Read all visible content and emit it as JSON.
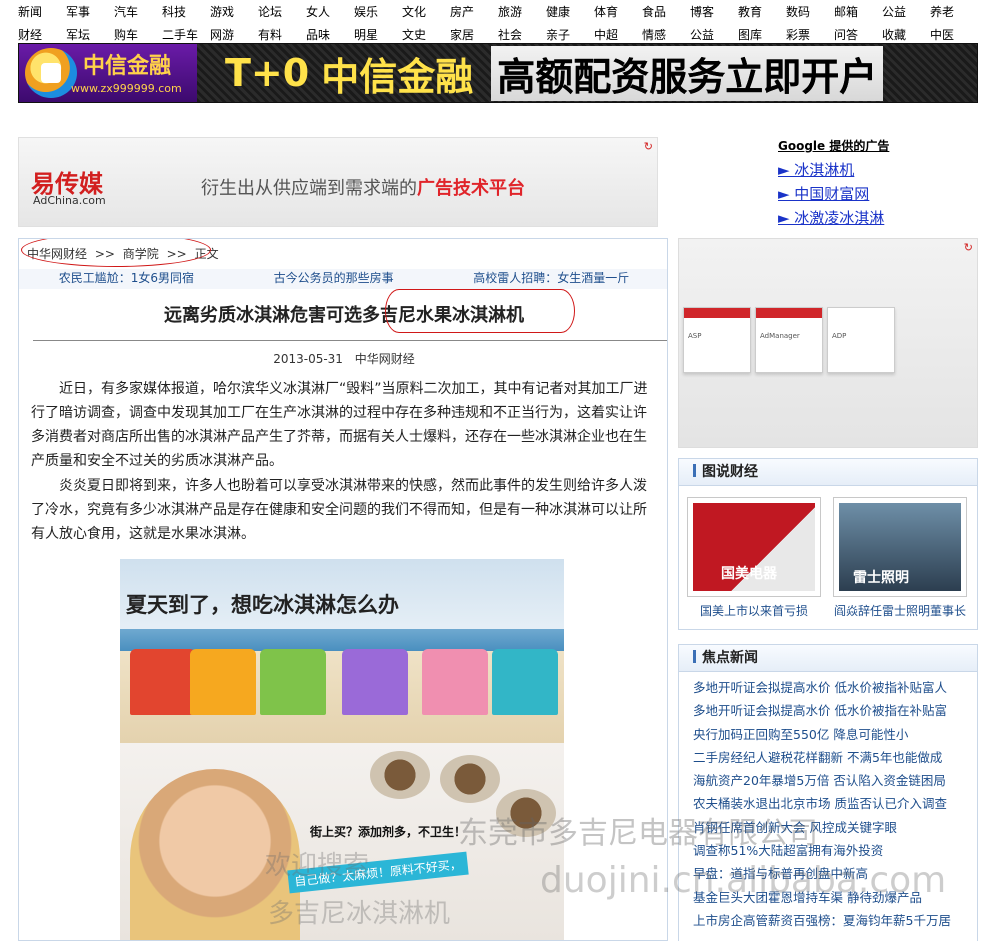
{
  "nav": {
    "row1": [
      "新闻",
      "军事",
      "汽车",
      "科技",
      "游戏",
      "论坛",
      "女人",
      "娱乐",
      "文化",
      "房产",
      "旅游",
      "健康",
      "体育",
      "食品",
      "博客",
      "教育",
      "数码",
      "邮箱",
      "公益",
      "养老"
    ],
    "row2": [
      "财经",
      "军坛",
      "购车",
      "二手车",
      "网游",
      "有料",
      "品味",
      "明星",
      "文史",
      "家居",
      "社会",
      "亲子",
      "中超",
      "情感",
      "公益",
      "图库",
      "彩票",
      "问答",
      "收藏",
      "中医"
    ]
  },
  "banner": {
    "logo_name": "中信金融",
    "logo_url": "www.zx999999.com",
    "slogan_t0": "T+0",
    "slogan_brand": "中信金融",
    "slogan_rest": "高额配资服务立即开户"
  },
  "adchina": {
    "brand": "易传媒",
    "brand_url": "AdChina.com",
    "tagline_plain": "衍生出从供应端到需求端的",
    "tagline_highlight": "广告技术平台"
  },
  "google_ads": {
    "title": "Google 提供的广告",
    "items": [
      "► 冰淇淋机",
      "► 中国财富网",
      "► 冰激凌冰淇淋"
    ]
  },
  "breadcrumb": [
    "中华网财经",
    ">>",
    "商学院",
    ">>",
    "正文"
  ],
  "headlines": [
    "农民工尴尬：1女6男同宿",
    "古今公务员的那些房事",
    "高校雷人招聘：女生酒量一斤"
  ],
  "article": {
    "title": "远离劣质冰淇淋危害可选多吉尼水果冰淇淋机",
    "date": "2013-05-31",
    "source": "中华网财经",
    "paragraphs": [
      "近日，有多家媒体报道，哈尔滨华义冰淇淋厂“毁料”当原料二次加工，其中有记者对其加工厂进行了暗访调查，调查中发现其加工厂在生产冰淇淋的过程中存在多种违规和不正当行为，这着实让许多消费者对商店所出售的冰淇淋产品产生了芥蒂，而据有关人士爆料，还存在一些冰淇淋企业也在生产质量和安全不过关的劣质冰淇淋产品。",
      "炎炎夏日即将到来，许多人也盼着可以享受冰淇淋带来的快感，然而此事件的发生则给许多人泼了冷水，究竟有多少冰淇淋产品是存在健康和安全问题的我们不得而知，但是有一种冰淇淋可以让所有人放心食用，这就是水果冰淇淋。"
    ],
    "photo_caption": "夏天到了，想吃冰淇淋怎么办",
    "photo_text1": "街上买？添加剂多，不卫生！",
    "photo_text2": "自己做？太麻烦！原料不好买，",
    "photo_wm1": "欢迎搜索",
    "photo_wm2": "多吉尼冰淇淋机"
  },
  "watermark": {
    "line1": "东莞市多吉尼电器有限公司",
    "line2": "duojini.cn.alibaba.com"
  },
  "side_ad": {
    "cards": [
      "ASP",
      "AdManager",
      "ADP"
    ]
  },
  "picnews": {
    "title": "图说财经",
    "items": [
      "国美上市以来首亏损",
      "阎焱辞任雷士照明董事长"
    ],
    "img_text": [
      "国美电器",
      "雷士照明"
    ]
  },
  "focus": {
    "title": "焦点新闻",
    "items": [
      "多地开听证会拟提高水价  低水价被指补贴富人",
      "多地开听证会拟提高水价  低水价被指在补贴富",
      "央行加码正回购至550亿  降息可能性小",
      "二手房经纪人避税花样翻新  不满5年也能做成",
      "海航资产20年暴增5万倍  否认陷入资金链困局",
      "农夫桶装水退出北京市场  质监否认已介入调查",
      "肖钢任席首创新大会  风控成关键字眼",
      "调查称51%大陆超富拥有海外投资",
      "早盘：道指与标普再创盘中新高",
      "基金巨头大团霍恩增持车渠  静待劲爆产品",
      "上市房企高管薪资百强榜：夏海钧年薪5千万居"
    ]
  }
}
